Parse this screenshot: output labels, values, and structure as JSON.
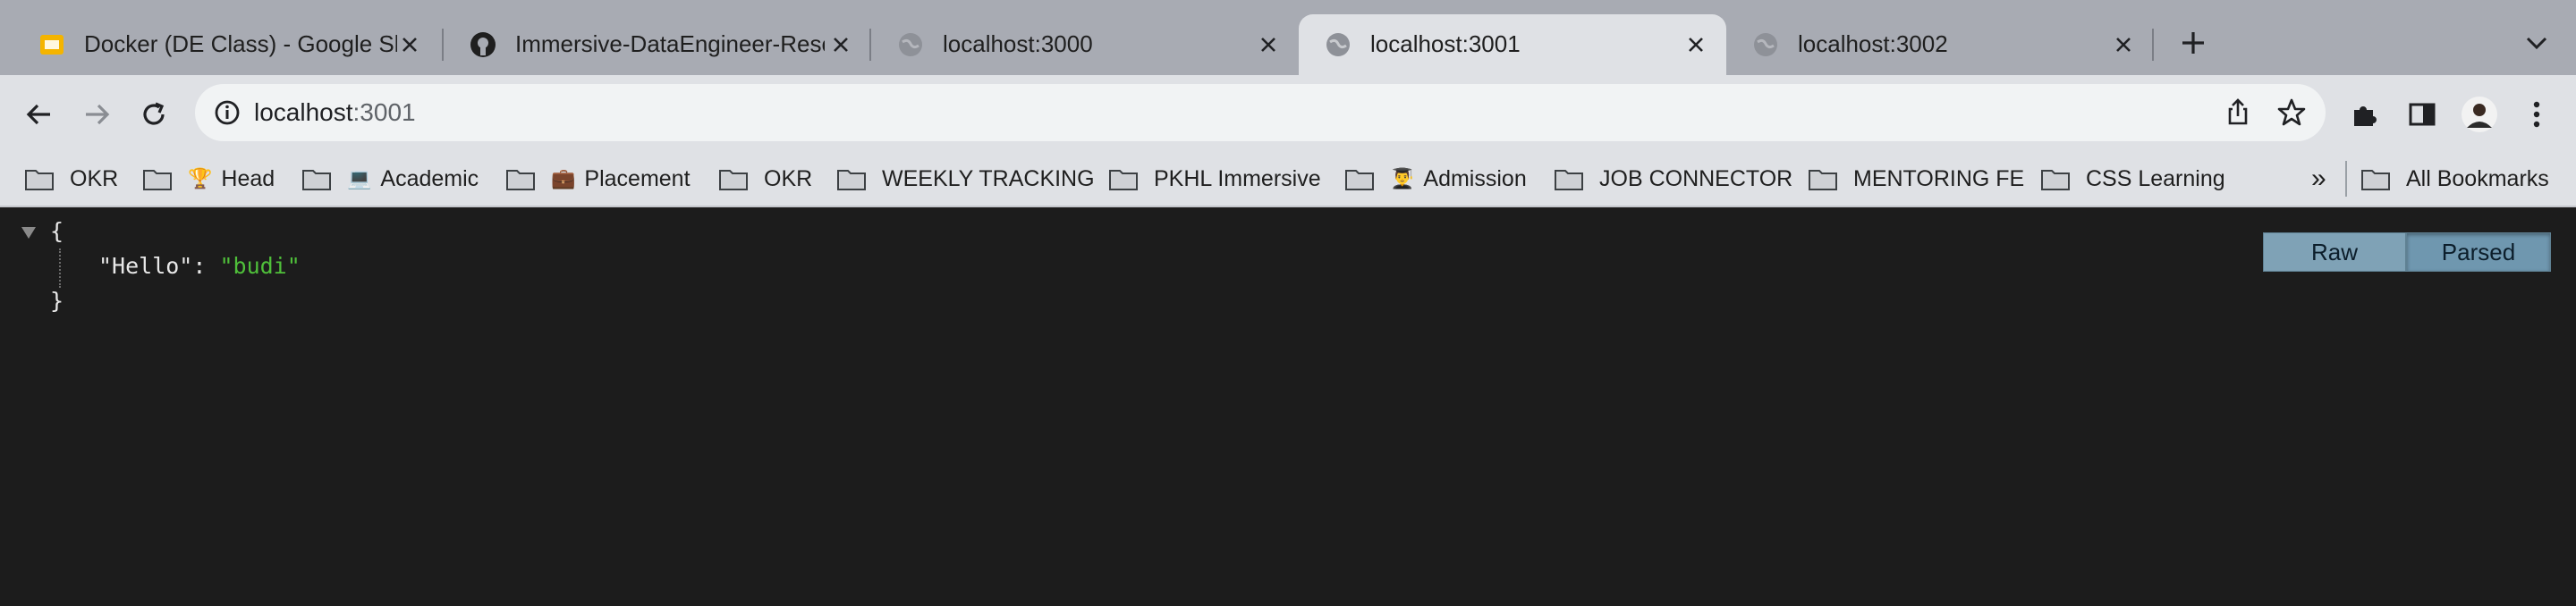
{
  "tabs": [
    {
      "title": "Docker (DE Class) - Google Sl",
      "favicon": "slides-icon",
      "active": false
    },
    {
      "title": "Immersive-DataEngineer-Reso",
      "favicon": "github-icon",
      "active": false
    },
    {
      "title": "localhost:3000",
      "favicon": "globe-icon",
      "active": false
    },
    {
      "title": "localhost:3001",
      "favicon": "globe-icon",
      "active": true
    },
    {
      "title": "localhost:3002",
      "favicon": "globe-icon",
      "active": false
    }
  ],
  "omnibox": {
    "host": "localhost",
    "port": ":3001"
  },
  "bookmarks": [
    {
      "label": "OKR",
      "emoji": ""
    },
    {
      "label": "Head",
      "emoji": "🏆"
    },
    {
      "label": "Academic",
      "emoji": "💻"
    },
    {
      "label": "Placement",
      "emoji": "💼"
    },
    {
      "label": "OKR",
      "emoji": ""
    },
    {
      "label": "WEEKLY TRACKING",
      "emoji": ""
    },
    {
      "label": "PKHL Immersive",
      "emoji": ""
    },
    {
      "label": "Admission",
      "emoji": "👨‍🎓"
    },
    {
      "label": "JOB CONNECTOR",
      "emoji": ""
    },
    {
      "label": "MENTORING FE",
      "emoji": ""
    },
    {
      "label": "CSS Learning",
      "emoji": ""
    }
  ],
  "bookmarks_overflow": "»",
  "all_bookmarks": "All Bookmarks",
  "json_viewer": {
    "open_brace": "{",
    "close_brace": "}",
    "key": "\"Hello\"",
    "colon": ": ",
    "value": "\"budi\"",
    "raw_label": "Raw",
    "parsed_label": "Parsed"
  },
  "colors": {
    "tabstrip": "#a8abb3",
    "toolbar": "#dfe1e5",
    "page_bg": "#1c1c1c",
    "string_value": "#4fbf3a",
    "view_button": "#7fa2b6"
  }
}
